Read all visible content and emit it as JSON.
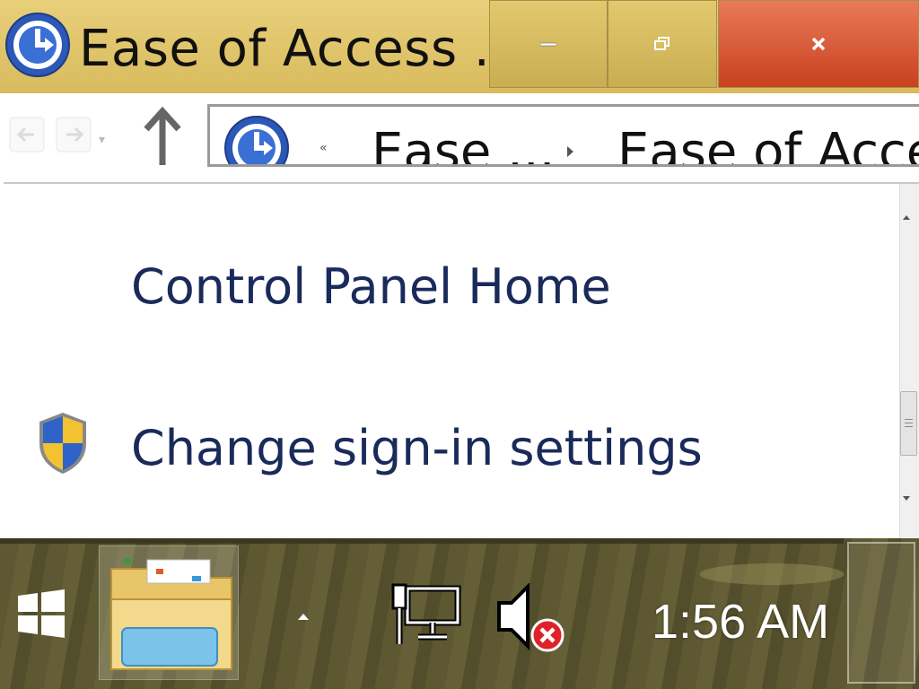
{
  "window": {
    "title": "Ease of Access ...",
    "icon": "ease-of-access-icon",
    "buttons": {
      "minimize": "minimize-icon",
      "maximize": "restore-icon",
      "close": "close-icon"
    }
  },
  "navigation": {
    "back": "back-arrow-icon",
    "forward": "forward-arrow-icon",
    "up": "up-arrow-icon",
    "address_overflow": "«",
    "breadcrumbs": [
      "Ease ...",
      "Ease of Access"
    ]
  },
  "content": {
    "links": [
      {
        "label": "Control Panel Home"
      },
      {
        "label": "Change sign-in settings",
        "icon": "uac-shield-icon"
      }
    ]
  },
  "taskbar": {
    "start": "windows-logo-icon",
    "pinned": [
      "file-explorer-icon"
    ],
    "tray": {
      "overflow": "show-hidden-icons-arrow",
      "network": "network-wired-icon",
      "volume": "volume-muted-error-icon"
    },
    "clock": "1:56 AM"
  },
  "colors": {
    "titlebar": "#e0c56c",
    "close_button": "#d4532e",
    "link_text": "#1a2a5a"
  }
}
